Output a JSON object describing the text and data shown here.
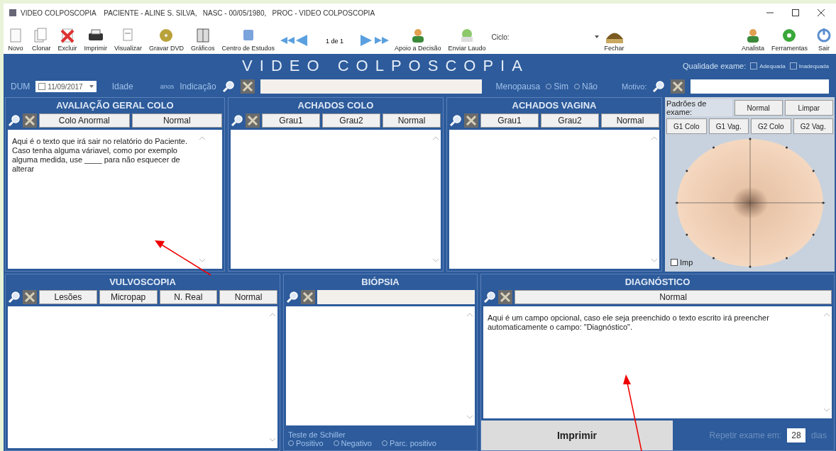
{
  "window": {
    "title": "VIDEO COLPOSCOPIA    PACIENTE - ALINE S. SILVA,   NASC - 00/05/1980,   PROC - VIDEO COLPOSCOPIA"
  },
  "toolbar": {
    "left": [
      {
        "label": "Novo",
        "kind": "page"
      },
      {
        "label": "Clonar",
        "kind": "copy"
      },
      {
        "label": "Excluir",
        "kind": "delete"
      },
      {
        "label": "Imprimir",
        "kind": "printer"
      },
      {
        "label": "Visualizar",
        "kind": "preview"
      },
      {
        "label": "Gravar DVD",
        "kind": "disc"
      },
      {
        "label": "Gráficos",
        "kind": "book"
      },
      {
        "label": "Centro de Estudos",
        "kind": "cube"
      }
    ],
    "pager": "1 de 1",
    "middle": [
      {
        "label": "Apoio a Decisão",
        "kind": "person"
      },
      {
        "label": "Enviar Laudo",
        "kind": "mail"
      }
    ],
    "cycle_label": "Ciclo:",
    "close_button": {
      "label": "Fechar",
      "kind": "hat"
    },
    "right": [
      {
        "label": "Analista",
        "kind": "person"
      },
      {
        "label": "Ferramentas",
        "kind": "gear"
      },
      {
        "label": "Sair",
        "kind": "power"
      }
    ]
  },
  "header": {
    "title": "VIDEO COLPOSCOPIA",
    "quality_label": "Qualidade exame:",
    "quality_options": [
      {
        "label": "Adequada",
        "checked": false
      },
      {
        "label": "Inadequada",
        "checked": false
      }
    ]
  },
  "fields": {
    "dum_label": "DUM",
    "dum_value": "11/09/2017",
    "dum_checked": false,
    "age_label": "Idade",
    "age_unit": "anos",
    "indication_label": "Indicação",
    "menopause_label": "Menopausa",
    "menopause_options": [
      {
        "label": "Sim",
        "selected": false
      },
      {
        "label": "Não",
        "selected": false
      }
    ],
    "motive_label": "Motivo:"
  },
  "top_panels": [
    {
      "title": "AVALIAÇÃO GERAL COLO",
      "buttons": [
        "Colo Anormal",
        "Normal"
      ],
      "text": "Aqui é o texto que irá sair no relatório do Paciente. Caso tenha alguma váriavel, como por exemplo alguma medida, use ____ para não esquecer de alterar"
    },
    {
      "title": "ACHADOS COLO",
      "buttons": [
        "Grau1",
        "Grau2",
        "Normal"
      ]
    },
    {
      "title": "ACHADOS VAGINA",
      "buttons": [
        "Grau1",
        "Grau2",
        "Normal"
      ]
    }
  ],
  "patterns": {
    "title": "Padrões de exame:",
    "buttons": [
      "Normal",
      "Limpar"
    ],
    "groups": [
      "G1 Colo",
      "G1 Vag.",
      "G2 Colo",
      "G2 Vag."
    ],
    "imp": {
      "label": "Imp",
      "checked": false
    }
  },
  "vulvoscopy": {
    "title": "VULVOSCOPIA",
    "buttons": [
      "Lesões",
      "Micropap",
      "N. Real",
      "Normal"
    ]
  },
  "biopsy": {
    "title": "BIÓPSIA",
    "schiller_label": "Teste de Schiller",
    "schiller_options": [
      {
        "label": "Positivo",
        "selected": false
      },
      {
        "label": "Negativo",
        "selected": false
      },
      {
        "label": "Parc. positivo",
        "selected": false
      }
    ]
  },
  "diagnosis": {
    "title": "DIAGNÓSTICO",
    "buttons": [
      "Normal"
    ],
    "text": "Aqui é um campo opcional, caso ele seja preenchido o texto escrito irá preencher automaticamente o campo: \"Diagnóstico\".",
    "print_button": "Imprimir",
    "repeat_label": "Repetir exame em:",
    "repeat_value": "28",
    "repeat_unit": "dias"
  }
}
